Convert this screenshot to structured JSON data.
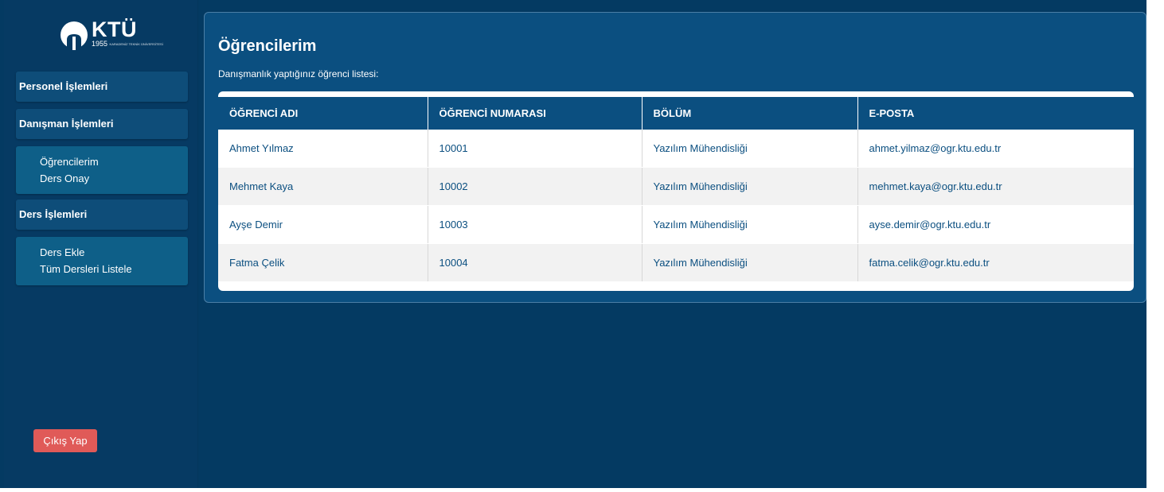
{
  "brand": {
    "name": "KTÜ",
    "year": "1955",
    "tagline": "KARADENİZ TEKNİK ÜNİVERSİTESİ"
  },
  "sidebar": {
    "sections": [
      {
        "label": "Personel İşlemleri"
      },
      {
        "label": "Danışman İşlemleri",
        "items": [
          "Öğrencilerim",
          "Ders Onay"
        ]
      },
      {
        "label": "Ders İşlemleri",
        "items": [
          "Ders Ekle",
          "Tüm Dersleri Listele"
        ]
      }
    ],
    "logout_label": "Çıkış Yap"
  },
  "main": {
    "title": "Öğrencilerim",
    "subtitle": "Danışmanlık yaptığınız öğrenci listesi:",
    "table": {
      "columns": [
        "ÖĞRENCİ ADI",
        "ÖĞRENCİ NUMARASI",
        "BÖLÜM",
        "E-POSTA"
      ],
      "rows": [
        [
          "Ahmet Yılmaz",
          "10001",
          "Yazılım Mühendisliği",
          "ahmet.yilmaz@ogr.ktu.edu.tr"
        ],
        [
          "Mehmet Kaya",
          "10002",
          "Yazılım Mühendisliği",
          "mehmet.kaya@ogr.ktu.edu.tr"
        ],
        [
          "Ayşe Demir",
          "10003",
          "Yazılım Mühendisliği",
          "ayse.demir@ogr.ktu.edu.tr"
        ],
        [
          "Fatma Çelik",
          "10004",
          "Yazılım Mühendisliği",
          "fatma.celik@ogr.ktu.edu.tr"
        ]
      ]
    }
  },
  "colors": {
    "background": "#043a62",
    "panel": "#0b4f80",
    "nav_section": "#0e4d79",
    "nav_sub": "#0e5f88",
    "logout": "#e05a58"
  }
}
